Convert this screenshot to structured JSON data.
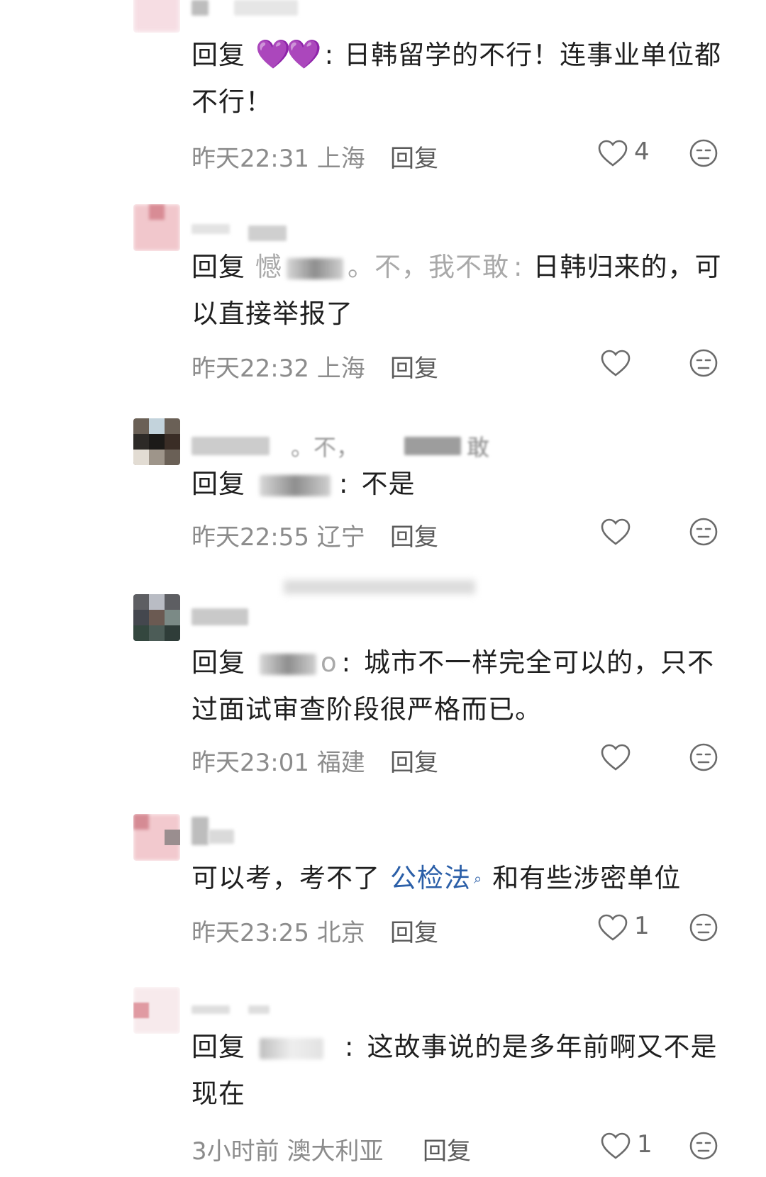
{
  "comments": [
    {
      "name_visible": "",
      "text_prefix": "回复",
      "reply_to_emoji": "💜💜",
      "text_colon": ":",
      "text_body": "日韩留学的不行！连事业单位都不行！",
      "time": "昨天22:31",
      "location": "上海",
      "reply_label": "回复",
      "likes": "4"
    },
    {
      "text_prefix": "回复",
      "reply_to_partial": "憾",
      "reply_to_tail": "。不，我不敢",
      "text_colon": ":",
      "text_body": "日韩归来的，可以直接举报了",
      "time": "昨天22:32",
      "location": "上海",
      "reply_label": "回复",
      "likes": ""
    },
    {
      "name_partial": "。不，",
      "name_tail": "敢",
      "text_prefix": "回复",
      "text_colon": ":",
      "text_body": "不是",
      "time": "昨天22:55",
      "location": "辽宁",
      "reply_label": "回复",
      "likes": ""
    },
    {
      "text_prefix": "回复",
      "reply_to_tail": "o",
      "text_colon": ":",
      "text_body": "城市不一样完全可以的，只不过面试审查阶段很严格而已。",
      "time": "昨天23:01",
      "location": "福建",
      "reply_label": "回复",
      "likes": ""
    },
    {
      "text_before": "可以考，考不了",
      "link_text": "公检法",
      "text_after": "和有些涉密单位",
      "time": "昨天23:25",
      "location": "北京",
      "reply_label": "回复",
      "likes": "1"
    },
    {
      "text_prefix": "回复",
      "text_colon": ":",
      "text_body": "这故事说的是多年前啊又不是现在",
      "time": "3小时前",
      "location": "澳大利亚",
      "reply_label": "回复",
      "likes": "1"
    }
  ],
  "colors": {
    "text": "#1f1f1f",
    "meta": "#8c8c8c",
    "link": "#2b5fa8",
    "heart_emoji": "#7a1fb8"
  },
  "icons": {
    "like": "heart-outline-icon",
    "dislike": "neutral-face-icon",
    "link_search": "search-icon"
  }
}
